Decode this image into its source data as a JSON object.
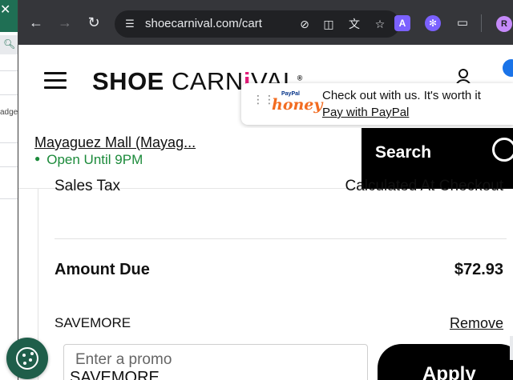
{
  "background_window": {
    "close_glyph": "✕",
    "search_icon": "search-icon",
    "partial_text": "adge"
  },
  "browser": {
    "url": "shoecarnival.com/cart",
    "profile_initial": "R",
    "extension_a_label": "A"
  },
  "site": {
    "logo_shoe": "SHOE",
    "logo_carnival_a": "CARN",
    "logo_carnival_b": "VAL",
    "logo_mark": "®",
    "brand_color": "#e31c79"
  },
  "honey": {
    "paypal_text": "PayPal",
    "honey_text": "honey",
    "message": "Check out with us. It's worth it",
    "link": "Pay with PayPal"
  },
  "store": {
    "name": "Mayaguez Mall  (Mayag...",
    "status": "Open Until 9PM",
    "status_color": "#1b8a3a",
    "search_label": "Search"
  },
  "summary": {
    "sales_tax_label": "Sales Tax",
    "sales_tax_value": "Calculated At Checkout",
    "amount_due_label": "Amount Due",
    "amount_due_value": "$72.93",
    "promo_code": "SAVEMORE",
    "remove_label": "Remove",
    "promo_placeholder": "Enter a promo",
    "promo_value": "SAVEMORE",
    "apply_label": "Apply"
  }
}
